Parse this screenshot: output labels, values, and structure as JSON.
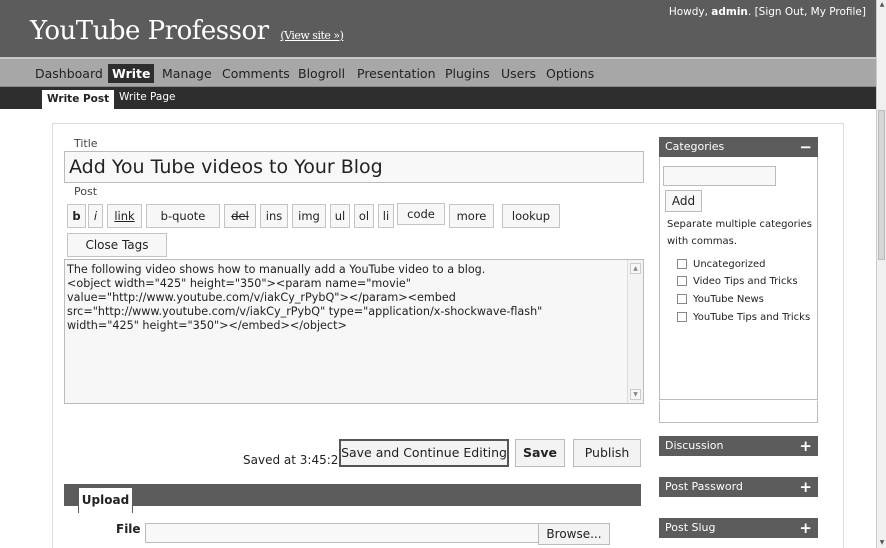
{
  "header": {
    "site_title": "YouTube Professor",
    "view_site": "(View site »)",
    "howdy": "Howdy,",
    "username": "admin",
    "user_links": ". [Sign Out, My Profile]"
  },
  "nav": {
    "main": [
      "Dashboard",
      "Write",
      "Manage",
      "Comments",
      "Blogroll",
      "Presentation",
      "Plugins",
      "Users",
      "Options"
    ],
    "active_main": "Write",
    "sub": [
      "Write Post",
      "Write Page"
    ],
    "active_sub": "Write Post"
  },
  "editor": {
    "title_label": "Title",
    "title_value": "Add You Tube videos to Your Blog",
    "post_label": "Post",
    "quicktags": [
      "b",
      "i",
      "link",
      "b-quote",
      "del",
      "ins",
      "img",
      "ul",
      "ol",
      "li",
      "code",
      "more",
      "lookup"
    ],
    "close_tags": "Close Tags",
    "post_content": "The following video shows how to manually add a YouTube video to a blog.\n<object width=\"425\" height=\"350\"><param name=\"movie\"\nvalue=\"http://www.youtube.com/v/iakCy_rPybQ\"></param><embed\nsrc=\"http://www.youtube.com/v/iakCy_rPybQ\" type=\"application/x-shockwave-flash\"\nwidth=\"425\" height=\"350\"></embed></object>"
  },
  "actions": {
    "saved_at": "Saved at 3:45:25.",
    "save_continue": "Save and Continue Editing",
    "save": "Save",
    "publish": "Publish"
  },
  "upload": {
    "tab": "Upload",
    "file_label": "File",
    "browse": "Browse..."
  },
  "sidebar": {
    "categories": {
      "title": "Categories",
      "toggle": "−",
      "add_button": "Add",
      "help": "Separate multiple categories with commas.",
      "items": [
        "Uncategorized",
        "Video Tips and Tricks",
        "YouTube News",
        "YouTube Tips and Tricks"
      ]
    },
    "discussion": {
      "title": "Discussion",
      "toggle": "+"
    },
    "post_password": {
      "title": "Post Password",
      "toggle": "+"
    },
    "post_slug": {
      "title": "Post Slug",
      "toggle": "+"
    }
  }
}
